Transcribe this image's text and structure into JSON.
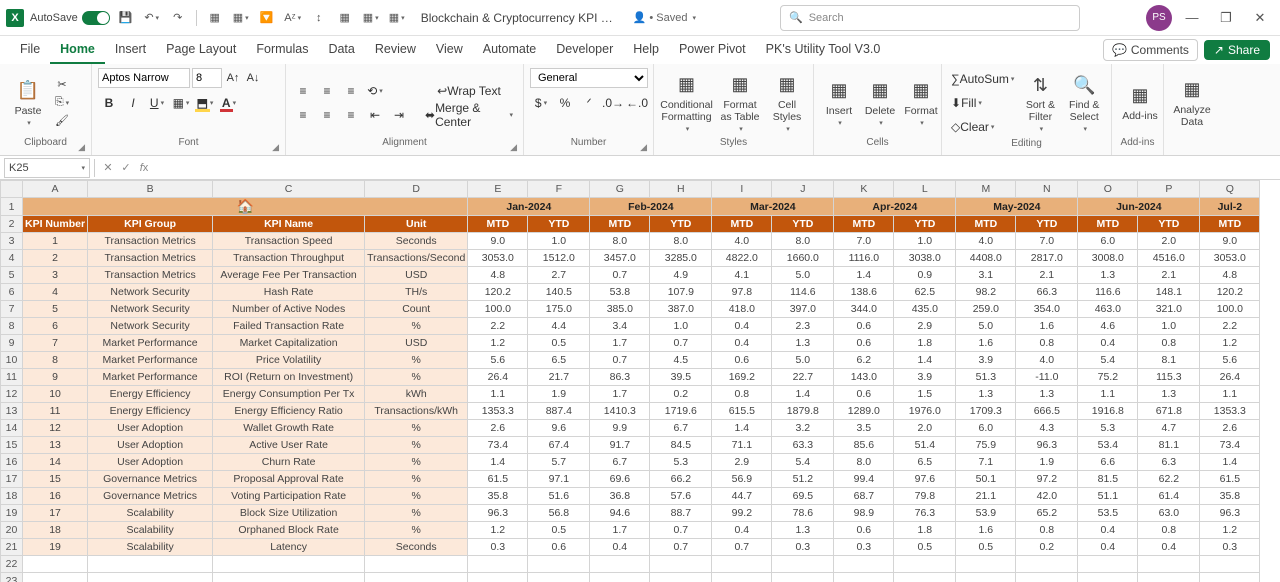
{
  "titlebar": {
    "autosave": "AutoSave",
    "file": "Blockchain & Cryptocurrency KPI Dashb…",
    "saved": "Saved",
    "search_ph": "Search",
    "avatar": "PS"
  },
  "tabs": [
    "File",
    "Home",
    "Insert",
    "Page Layout",
    "Formulas",
    "Data",
    "Review",
    "View",
    "Automate",
    "Developer",
    "Help",
    "Power Pivot",
    "PK's Utility Tool V3.0"
  ],
  "tabs_active": 1,
  "comments": "Comments",
  "share": "Share",
  "ribbon": {
    "paste": "Paste",
    "clipboard": "Clipboard",
    "font_name": "Aptos Narrow",
    "font_size": "8",
    "font": "Font",
    "wrap": "Wrap Text",
    "merge": "Merge & Center",
    "alignment": "Alignment",
    "num_fmt": "General",
    "number": "Number",
    "cond": "Conditional Formatting",
    "fmt_table": "Format as Table",
    "cell_styles": "Cell Styles",
    "styles": "Styles",
    "insert": "Insert",
    "delete": "Delete",
    "format": "Format",
    "cells": "Cells",
    "autosum": "AutoSum",
    "fill": "Fill",
    "clear": "Clear",
    "editing": "Editing",
    "sort": "Sort & Filter",
    "find": "Find & Select",
    "addins": "Add-ins",
    "analyze": "Analyze Data"
  },
  "namebox": "K25",
  "cols": [
    "A",
    "B",
    "C",
    "D",
    "E",
    "F",
    "G",
    "H",
    "I",
    "J",
    "K",
    "L",
    "M",
    "N",
    "O",
    "P",
    "Q"
  ],
  "months": [
    "Jan-2024",
    "Feb-2024",
    "Mar-2024",
    "Apr-2024",
    "May-2024",
    "Jun-2024",
    "Jul-2"
  ],
  "mtd": "MTD",
  "ytd": "YTD",
  "hdr": {
    "num": "KPI Number",
    "grp": "KPI Group",
    "name": "KPI Name",
    "unit": "Unit"
  },
  "rows": [
    {
      "n": "1",
      "g": "Transaction Metrics",
      "k": "Transaction Speed",
      "u": "Seconds",
      "v": [
        "9.0",
        "1.0",
        "8.0",
        "8.0",
        "4.0",
        "8.0",
        "7.0",
        "1.0",
        "4.0",
        "7.0",
        "6.0",
        "2.0",
        "9.0"
      ]
    },
    {
      "n": "2",
      "g": "Transaction Metrics",
      "k": "Transaction Throughput",
      "u": "Transactions/Second",
      "v": [
        "3053.0",
        "1512.0",
        "3457.0",
        "3285.0",
        "4822.0",
        "1660.0",
        "1116.0",
        "3038.0",
        "4408.0",
        "2817.0",
        "3008.0",
        "4516.0",
        "3053.0"
      ]
    },
    {
      "n": "3",
      "g": "Transaction Metrics",
      "k": "Average Fee Per Transaction",
      "u": "USD",
      "v": [
        "4.8",
        "2.7",
        "0.7",
        "4.9",
        "4.1",
        "5.0",
        "1.4",
        "0.9",
        "3.1",
        "2.1",
        "1.3",
        "2.1",
        "4.8"
      ]
    },
    {
      "n": "4",
      "g": "Network Security",
      "k": "Hash Rate",
      "u": "TH/s",
      "v": [
        "120.2",
        "140.5",
        "53.8",
        "107.9",
        "97.8",
        "114.6",
        "138.6",
        "62.5",
        "98.2",
        "66.3",
        "116.6",
        "148.1",
        "120.2"
      ]
    },
    {
      "n": "5",
      "g": "Network Security",
      "k": "Number of Active Nodes",
      "u": "Count",
      "v": [
        "100.0",
        "175.0",
        "385.0",
        "387.0",
        "418.0",
        "397.0",
        "344.0",
        "435.0",
        "259.0",
        "354.0",
        "463.0",
        "321.0",
        "100.0"
      ]
    },
    {
      "n": "6",
      "g": "Network Security",
      "k": "Failed Transaction Rate",
      "u": "%",
      "v": [
        "2.2",
        "4.4",
        "3.4",
        "1.0",
        "0.4",
        "2.3",
        "0.6",
        "2.9",
        "5.0",
        "1.6",
        "4.6",
        "1.0",
        "2.2"
      ]
    },
    {
      "n": "7",
      "g": "Market Performance",
      "k": "Market Capitalization",
      "u": "USD",
      "v": [
        "1.2",
        "0.5",
        "1.7",
        "0.7",
        "0.4",
        "1.3",
        "0.6",
        "1.8",
        "1.6",
        "0.8",
        "0.4",
        "0.8",
        "1.2"
      ]
    },
    {
      "n": "8",
      "g": "Market Performance",
      "k": "Price Volatility",
      "u": "%",
      "v": [
        "5.6",
        "6.5",
        "0.7",
        "4.5",
        "0.6",
        "5.0",
        "6.2",
        "1.4",
        "3.9",
        "4.0",
        "5.4",
        "8.1",
        "5.6"
      ]
    },
    {
      "n": "9",
      "g": "Market Performance",
      "k": "ROI (Return on Investment)",
      "u": "%",
      "v": [
        "26.4",
        "21.7",
        "86.3",
        "39.5",
        "169.2",
        "22.7",
        "143.0",
        "3.9",
        "51.3",
        "-11.0",
        "75.2",
        "115.3",
        "26.4"
      ]
    },
    {
      "n": "10",
      "g": "Energy Efficiency",
      "k": "Energy Consumption Per Tx",
      "u": "kWh",
      "v": [
        "1.1",
        "1.9",
        "1.7",
        "0.2",
        "0.8",
        "1.4",
        "0.6",
        "1.5",
        "1.3",
        "1.3",
        "1.1",
        "1.3",
        "1.1"
      ]
    },
    {
      "n": "11",
      "g": "Energy Efficiency",
      "k": "Energy Efficiency Ratio",
      "u": "Transactions/kWh",
      "v": [
        "1353.3",
        "887.4",
        "1410.3",
        "1719.6",
        "615.5",
        "1879.8",
        "1289.0",
        "1976.0",
        "1709.3",
        "666.5",
        "1916.8",
        "671.8",
        "1353.3"
      ]
    },
    {
      "n": "12",
      "g": "User Adoption",
      "k": "Wallet Growth Rate",
      "u": "%",
      "v": [
        "2.6",
        "9.6",
        "9.9",
        "6.7",
        "1.4",
        "3.2",
        "3.5",
        "2.0",
        "6.0",
        "4.3",
        "5.3",
        "4.7",
        "2.6"
      ]
    },
    {
      "n": "13",
      "g": "User Adoption",
      "k": "Active User Rate",
      "u": "%",
      "v": [
        "73.4",
        "67.4",
        "91.7",
        "84.5",
        "71.1",
        "63.3",
        "85.6",
        "51.4",
        "75.9",
        "96.3",
        "53.4",
        "81.1",
        "73.4"
      ]
    },
    {
      "n": "14",
      "g": "User Adoption",
      "k": "Churn Rate",
      "u": "%",
      "v": [
        "1.4",
        "5.7",
        "6.7",
        "5.3",
        "2.9",
        "5.4",
        "8.0",
        "6.5",
        "7.1",
        "1.9",
        "6.6",
        "6.3",
        "1.4"
      ]
    },
    {
      "n": "15",
      "g": "Governance Metrics",
      "k": "Proposal Approval Rate",
      "u": "%",
      "v": [
        "61.5",
        "97.1",
        "69.6",
        "66.2",
        "56.9",
        "51.2",
        "99.4",
        "97.6",
        "50.1",
        "97.2",
        "81.5",
        "62.2",
        "61.5"
      ]
    },
    {
      "n": "16",
      "g": "Governance Metrics",
      "k": "Voting Participation Rate",
      "u": "%",
      "v": [
        "35.8",
        "51.6",
        "36.8",
        "57.6",
        "44.7",
        "69.5",
        "68.7",
        "79.8",
        "21.1",
        "42.0",
        "51.1",
        "61.4",
        "35.8"
      ]
    },
    {
      "n": "17",
      "g": "Scalability",
      "k": "Block Size Utilization",
      "u": "%",
      "v": [
        "96.3",
        "56.8",
        "94.6",
        "88.7",
        "99.2",
        "78.6",
        "98.9",
        "76.3",
        "53.9",
        "65.2",
        "53.5",
        "63.0",
        "96.3"
      ]
    },
    {
      "n": "18",
      "g": "Scalability",
      "k": "Orphaned Block Rate",
      "u": "%",
      "v": [
        "1.2",
        "0.5",
        "1.7",
        "0.7",
        "0.4",
        "1.3",
        "0.6",
        "1.8",
        "1.6",
        "0.8",
        "0.4",
        "0.8",
        "1.2"
      ]
    },
    {
      "n": "19",
      "g": "Scalability",
      "k": "Latency",
      "u": "Seconds",
      "v": [
        "0.3",
        "0.6",
        "0.4",
        "0.7",
        "0.7",
        "0.3",
        "0.3",
        "0.5",
        "0.5",
        "0.2",
        "0.4",
        "0.4",
        "0.3"
      ]
    }
  ]
}
